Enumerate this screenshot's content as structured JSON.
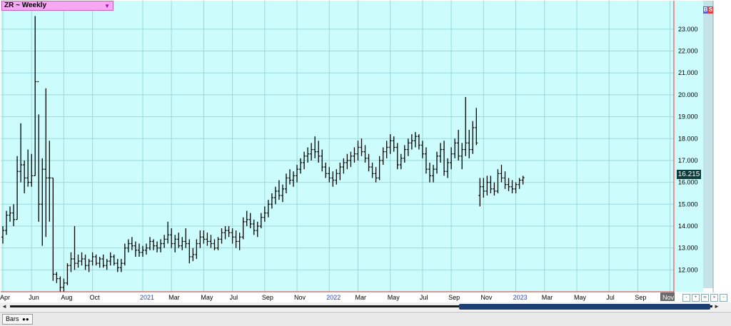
{
  "header": {
    "title": "ZR ~ Weekly",
    "dropdown_icon": "triangle-down-icon"
  },
  "bs_badge": {
    "b": "B",
    "s": "S",
    "b_color": "#5060d8",
    "s_color": "#e04040"
  },
  "last_price": "16.215",
  "colors": {
    "plot_bg": "#ccfcfc",
    "grid": "#9ed8dc",
    "bar": "#000000",
    "axis_border": "#e03030",
    "price_panel": "#c8e8ec"
  },
  "chart_data": {
    "type": "ohlc",
    "title": "ZR ~ Weekly",
    "ylim": [
      11.0,
      24.3
    ],
    "y_ticks": [
      "12.000",
      "13.000",
      "14.000",
      "15.000",
      "16.000",
      "17.000",
      "18.000",
      "19.000",
      "20.000",
      "21.000",
      "22.000",
      "23.000"
    ],
    "x_ticks": [
      {
        "label": "Apr",
        "week": 0
      },
      {
        "label": "Jun",
        "week": 8
      },
      {
        "label": "Aug",
        "week": 17
      },
      {
        "label": "Oct",
        "week": 25
      },
      {
        "label": "2021",
        "week": 39
      },
      {
        "label": "Mar",
        "week": 47
      },
      {
        "label": "May",
        "week": 56
      },
      {
        "label": "Jul",
        "week": 64
      },
      {
        "label": "Sep",
        "week": 73
      },
      {
        "label": "Nov",
        "week": 82
      },
      {
        "label": "2022",
        "week": 91
      },
      {
        "label": "Mar",
        "week": 99
      },
      {
        "label": "May",
        "week": 108
      },
      {
        "label": "Jul",
        "week": 117
      },
      {
        "label": "Sep",
        "week": 125
      },
      {
        "label": "Nov",
        "week": 134
      },
      {
        "label": "2023",
        "week": 143
      },
      {
        "label": "Mar",
        "week": 151
      },
      {
        "label": "May",
        "week": 160
      },
      {
        "label": "Jul",
        "week": 169
      },
      {
        "label": "Sep",
        "week": 177
      },
      {
        "label": "Nov",
        "week": 186
      }
    ],
    "year_labels": [
      "2021",
      "2022",
      "2023"
    ],
    "series": [
      {
        "name": "ZR Weekly",
        "values": [
          [
            13.5,
            14.0,
            13.2,
            13.8
          ],
          [
            13.8,
            14.7,
            13.6,
            14.5
          ],
          [
            14.5,
            14.9,
            14.2,
            14.6
          ],
          [
            14.6,
            15.0,
            14.0,
            14.3
          ],
          [
            14.3,
            17.2,
            14.3,
            16.5
          ],
          [
            16.5,
            18.7,
            16.0,
            16.8
          ],
          [
            16.8,
            17.0,
            15.5,
            16.2
          ],
          [
            16.2,
            17.5,
            15.8,
            16.0
          ],
          [
            16.0,
            17.3,
            15.8,
            16.3
          ],
          [
            16.3,
            23.6,
            16.3,
            20.6
          ],
          [
            20.6,
            19.1,
            14.2,
            15.0
          ],
          [
            15.0,
            17.1,
            13.1,
            16.6
          ],
          [
            16.6,
            20.3,
            13.5,
            16.2
          ],
          [
            16.2,
            17.9,
            14.2,
            16.2
          ],
          [
            16.2,
            16.2,
            11.5,
            11.8
          ],
          [
            11.8,
            11.9,
            11.4,
            11.6
          ],
          [
            11.6,
            11.7,
            11.0,
            11.2
          ],
          [
            11.2,
            11.6,
            11.0,
            11.4
          ],
          [
            11.4,
            12.3,
            11.3,
            12.2
          ],
          [
            12.2,
            12.8,
            11.9,
            12.5
          ],
          [
            12.5,
            14.0,
            12.0,
            12.3
          ],
          [
            12.3,
            12.7,
            12.1,
            12.4
          ],
          [
            12.4,
            12.8,
            12.2,
            12.5
          ],
          [
            12.5,
            12.7,
            12.0,
            12.2
          ],
          [
            12.2,
            12.5,
            11.9,
            12.4
          ],
          [
            12.4,
            12.8,
            12.2,
            12.6
          ],
          [
            12.6,
            12.7,
            12.2,
            12.3
          ],
          [
            12.3,
            12.6,
            12.1,
            12.5
          ],
          [
            12.5,
            12.7,
            12.1,
            12.2
          ],
          [
            12.2,
            12.5,
            12.0,
            12.4
          ],
          [
            12.4,
            12.8,
            12.2,
            12.6
          ],
          [
            12.6,
            12.7,
            12.2,
            12.3
          ],
          [
            12.3,
            12.5,
            11.9,
            12.1
          ],
          [
            12.1,
            12.5,
            11.9,
            12.3
          ],
          [
            12.3,
            13.2,
            12.2,
            13.0
          ],
          [
            13.0,
            13.4,
            12.8,
            13.2
          ],
          [
            13.2,
            13.5,
            12.9,
            13.1
          ],
          [
            13.1,
            13.3,
            12.6,
            12.9
          ],
          [
            12.9,
            13.2,
            12.6,
            12.8
          ],
          [
            12.8,
            13.1,
            12.6,
            12.9
          ],
          [
            12.9,
            13.2,
            12.7,
            13.0
          ],
          [
            13.0,
            13.5,
            12.9,
            13.3
          ],
          [
            13.3,
            13.4,
            12.9,
            13.1
          ],
          [
            13.1,
            13.3,
            12.8,
            13.0
          ],
          [
            13.0,
            13.4,
            12.8,
            13.2
          ],
          [
            13.2,
            13.6,
            13.0,
            13.4
          ],
          [
            13.4,
            14.2,
            13.2,
            13.6
          ],
          [
            13.6,
            13.9,
            13.0,
            13.2
          ],
          [
            13.2,
            13.6,
            12.8,
            13.4
          ],
          [
            13.4,
            13.7,
            13.0,
            13.1
          ],
          [
            13.1,
            13.5,
            12.9,
            13.3
          ],
          [
            13.3,
            13.9,
            13.0,
            13.2
          ],
          [
            13.2,
            13.4,
            12.3,
            12.6
          ],
          [
            12.6,
            13.0,
            12.4,
            12.7
          ],
          [
            12.7,
            13.4,
            12.5,
            13.2
          ],
          [
            13.2,
            13.8,
            13.0,
            13.5
          ],
          [
            13.5,
            13.8,
            13.2,
            13.4
          ],
          [
            13.4,
            13.7,
            13.1,
            13.3
          ],
          [
            13.3,
            13.6,
            13.0,
            13.2
          ],
          [
            13.2,
            13.4,
            12.9,
            13.0
          ],
          [
            13.0,
            13.5,
            12.9,
            13.4
          ],
          [
            13.4,
            13.9,
            13.2,
            13.7
          ],
          [
            13.7,
            14.0,
            13.4,
            13.8
          ],
          [
            13.8,
            14.0,
            13.5,
            13.7
          ],
          [
            13.7,
            13.9,
            13.2,
            13.5
          ],
          [
            13.5,
            13.8,
            13.0,
            13.3
          ],
          [
            13.3,
            13.7,
            12.9,
            13.5
          ],
          [
            13.5,
            14.4,
            13.4,
            14.2
          ],
          [
            14.2,
            14.7,
            14.0,
            14.3
          ],
          [
            14.3,
            14.6,
            13.9,
            14.1
          ],
          [
            14.1,
            14.3,
            13.6,
            13.8
          ],
          [
            13.8,
            14.2,
            13.5,
            14.0
          ],
          [
            14.0,
            14.6,
            13.9,
            14.4
          ],
          [
            14.4,
            14.9,
            14.2,
            14.6
          ],
          [
            14.6,
            15.2,
            14.4,
            15.0
          ],
          [
            15.0,
            15.5,
            14.8,
            15.3
          ],
          [
            15.3,
            15.8,
            15.0,
            15.6
          ],
          [
            15.6,
            16.1,
            15.2,
            15.4
          ],
          [
            15.4,
            15.9,
            15.1,
            15.7
          ],
          [
            15.7,
            16.4,
            15.5,
            16.2
          ],
          [
            16.2,
            16.6,
            15.9,
            16.1
          ],
          [
            16.1,
            16.5,
            15.8,
            16.3
          ],
          [
            16.3,
            16.8,
            16.0,
            16.6
          ],
          [
            16.6,
            17.1,
            16.4,
            16.9
          ],
          [
            16.9,
            17.4,
            16.6,
            17.2
          ],
          [
            17.2,
            17.6,
            16.9,
            17.3
          ],
          [
            17.3,
            17.8,
            17.0,
            17.5
          ],
          [
            17.5,
            18.1,
            17.1,
            17.4
          ],
          [
            17.4,
            17.9,
            16.9,
            17.2
          ],
          [
            17.2,
            17.5,
            16.5,
            16.7
          ],
          [
            16.7,
            16.9,
            16.2,
            16.4
          ],
          [
            16.4,
            16.7,
            16.0,
            16.2
          ],
          [
            16.2,
            16.5,
            15.8,
            16.1
          ],
          [
            16.1,
            16.6,
            15.9,
            16.4
          ],
          [
            16.4,
            16.9,
            16.1,
            16.7
          ],
          [
            16.7,
            17.1,
            16.4,
            16.9
          ],
          [
            16.9,
            17.3,
            16.6,
            17.0
          ],
          [
            17.0,
            17.4,
            16.7,
            17.2
          ],
          [
            17.2,
            17.6,
            16.9,
            17.3
          ],
          [
            17.3,
            17.9,
            17.0,
            17.6
          ],
          [
            17.6,
            18.0,
            17.2,
            17.4
          ],
          [
            17.4,
            17.7,
            16.9,
            17.1
          ],
          [
            17.1,
            17.3,
            16.5,
            16.7
          ],
          [
            16.7,
            16.9,
            16.2,
            16.4
          ],
          [
            16.4,
            16.7,
            16.0,
            16.2
          ],
          [
            16.2,
            17.2,
            16.1,
            17.0
          ],
          [
            17.0,
            17.6,
            16.8,
            17.4
          ],
          [
            17.4,
            17.9,
            17.1,
            17.6
          ],
          [
            17.6,
            18.2,
            17.3,
            17.9
          ],
          [
            17.9,
            18.1,
            17.4,
            17.6
          ],
          [
            17.6,
            17.8,
            16.6,
            16.8
          ],
          [
            16.8,
            17.3,
            16.6,
            17.1
          ],
          [
            17.1,
            17.7,
            16.9,
            17.5
          ],
          [
            17.5,
            18.0,
            17.2,
            17.8
          ],
          [
            17.8,
            18.2,
            17.5,
            17.9
          ],
          [
            17.9,
            18.3,
            17.6,
            18.1
          ],
          [
            18.1,
            18.2,
            17.5,
            17.7
          ],
          [
            17.7,
            17.9,
            17.1,
            17.3
          ],
          [
            17.3,
            17.6,
            16.4,
            16.6
          ],
          [
            16.6,
            16.9,
            16.0,
            16.3
          ],
          [
            16.3,
            16.8,
            16.0,
            16.6
          ],
          [
            16.6,
            17.4,
            16.4,
            17.2
          ],
          [
            17.2,
            17.8,
            16.9,
            17.5
          ],
          [
            17.5,
            17.9,
            16.3,
            16.5
          ],
          [
            16.5,
            17.1,
            16.2,
            16.9
          ],
          [
            16.9,
            17.6,
            16.6,
            17.3
          ],
          [
            17.3,
            18.0,
            17.1,
            17.8
          ],
          [
            17.8,
            18.4,
            17.0,
            17.2
          ],
          [
            17.2,
            17.8,
            16.6,
            17.5
          ],
          [
            17.5,
            19.9,
            17.2,
            17.8
          ],
          [
            17.8,
            18.4,
            17.1,
            17.5
          ],
          [
            17.5,
            18.8,
            17.3,
            18.5
          ],
          [
            18.5,
            19.4,
            17.7,
            17.8
          ],
          [
            15.4,
            16.2,
            14.9,
            15.8
          ],
          [
            15.8,
            16.2,
            15.3,
            15.6
          ],
          [
            15.6,
            16.3,
            15.4,
            16.0
          ],
          [
            16.0,
            16.3,
            15.5,
            15.7
          ],
          [
            15.7,
            16.0,
            15.4,
            15.6
          ],
          [
            15.6,
            16.6,
            15.5,
            16.4
          ],
          [
            16.4,
            16.8,
            16.0,
            16.2
          ],
          [
            16.2,
            16.5,
            15.7,
            15.9
          ],
          [
            15.9,
            16.2,
            15.6,
            15.8
          ],
          [
            15.8,
            16.1,
            15.5,
            15.7
          ],
          [
            15.7,
            16.0,
            15.5,
            15.9
          ],
          [
            15.9,
            16.2,
            15.7,
            16.1
          ],
          [
            16.1,
            16.3,
            15.9,
            16.215
          ]
        ]
      }
    ]
  },
  "bottom": {
    "tab_label": "Bars",
    "tab_icon": "glasses-icon"
  },
  "toolbar_icons": [
    "zoom-out-icon",
    "zoom-in-icon",
    "link-icon",
    "scroll-end-icon",
    "minus-icon",
    "plus-icon"
  ]
}
